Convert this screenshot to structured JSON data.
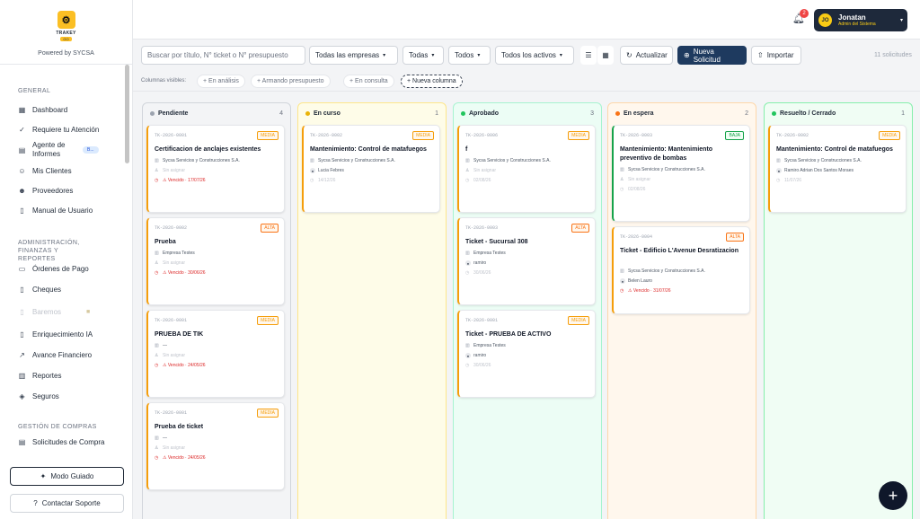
{
  "brand": {
    "name": "TRAKEY",
    "badge": "GO",
    "powered": "Powered by SYCSA"
  },
  "sidebar": {
    "sections": [
      {
        "title": "GENERAL",
        "items": [
          {
            "label": "Dashboard",
            "icon": "grid-icon"
          },
          {
            "label": "Requiere tu Atención",
            "icon": "check-circle-icon"
          },
          {
            "label": "Agente de Informes",
            "icon": "document-icon",
            "badge": "B..."
          },
          {
            "label": "Mis Clientes",
            "icon": "users-icon"
          },
          {
            "label": "Proveedores",
            "icon": "people-icon"
          },
          {
            "label": "Manual de Usuario",
            "icon": "book-icon"
          }
        ]
      },
      {
        "title": "ADMINISTRACIÓN, FINANZAS Y REPORTES",
        "items": [
          {
            "label": "Órdenes de Pago",
            "icon": "card-icon"
          },
          {
            "label": "Cheques",
            "icon": "file-icon"
          },
          {
            "label": "Baremos",
            "icon": "file-icon",
            "disabled": true
          },
          {
            "label": "Enriquecimiento IA",
            "icon": "file-icon"
          },
          {
            "label": "Avance Financiero",
            "icon": "trend-icon"
          },
          {
            "label": "Reportes",
            "icon": "bar-chart-icon"
          },
          {
            "label": "Seguros",
            "icon": "shield-icon"
          }
        ]
      },
      {
        "title": "GESTIÓN DE COMPRAS",
        "items": [
          {
            "label": "Solicitudes de Compra",
            "icon": "clipboard-icon"
          }
        ]
      }
    ],
    "guided_mode": "Modo Guiado",
    "support": "Contactar Soporte"
  },
  "header": {
    "notifications": "2",
    "user": {
      "initials": "JO",
      "name": "Jonatan",
      "role": "Admin del Sistema"
    }
  },
  "toolbar": {
    "search_placeholder": "Buscar por título, N° ticket o N° presupuesto",
    "filters": [
      "Todas las empresas",
      "Todas",
      "Todos",
      "Todos los activos"
    ],
    "refresh": "Actualizar",
    "new_request": "Nueva Solicitud",
    "import": "Importar",
    "count": "11 solicitudes"
  },
  "visible_columns": {
    "label": "Columnas visibles:",
    "options": [
      "+ En análisis",
      "+ Armando presupuesto",
      "+ En consulta",
      "+ Nueva columna"
    ]
  },
  "board": {
    "columns": [
      {
        "title": "Pendiente",
        "count": "4",
        "color": "#9ca3af",
        "bg": "#f3f4f6",
        "border": "#d1d5db",
        "accent": "#f59e0b",
        "cards": [
          {
            "id": "TK-2026-0001",
            "priority": "MEDIA",
            "title": "Certificacion de anclajes existentes",
            "company": "Sycsa Servicios y Construcciones S.A.",
            "assignee": "Sin asignar",
            "due": "⚠ Vencido · 17/07/26"
          },
          {
            "id": "TK-2026-0002",
            "priority": "ALTA",
            "title": "Prueba",
            "company": "Empresa Testes",
            "assignee": "Sin asignar",
            "due": "⚠ Vencido · 30/06/26"
          },
          {
            "id": "TK-2026-0001",
            "priority": "MEDIA",
            "title": "PRUEBA DE TIK",
            "company": "—",
            "assignee": "Sin asignar",
            "due": "⚠ Vencido · 24/05/26"
          },
          {
            "id": "TK-2026-0001",
            "priority": "MEDIA",
            "title": "Prueba de ticket",
            "company": "—",
            "assignee": "Sin asignar",
            "due": "⚠ Vencido · 24/05/26"
          }
        ]
      },
      {
        "title": "En curso",
        "count": "1",
        "color": "#eab308",
        "bg": "#fefce8",
        "border": "#fde68a",
        "accent": "#f59e0b",
        "cards": [
          {
            "id": "TK-2026-0002",
            "priority": "MEDIA",
            "title": "Mantenimiento: Control de matafuegos",
            "company": "Sycsa Servicios y Construcciones S.A.",
            "assignee": "Lucia Febres",
            "due": "14/12/26"
          }
        ]
      },
      {
        "title": "Aprobado",
        "count": "3",
        "color": "#22c55e",
        "bg": "#ecfdf5",
        "border": "#a7f3d0",
        "accent": "#f59e0b",
        "cards": [
          {
            "id": "TK-2026-0006",
            "priority": "MEDIA",
            "title": "f",
            "company": "Sycsa Servicios y Construcciones S.A.",
            "assignee": "Sin asignar",
            "due": "02/08/26"
          },
          {
            "id": "TK-2026-0003",
            "priority": "ALTA",
            "title": "Ticket - Sucursal 308",
            "company": "Empresa Testes",
            "assignee": "ramiro",
            "due": "30/06/26"
          },
          {
            "id": "TK-2026-0001",
            "priority": "MEDIA",
            "title": "Ticket - PRUEBA DE ACTIVO",
            "company": "Empresa Testes",
            "assignee": "ramiro",
            "due": "30/06/26"
          }
        ]
      },
      {
        "title": "En espera",
        "count": "2",
        "color": "#f97316",
        "bg": "#fff7ed",
        "border": "#fed7aa",
        "accent": "#f59e0b",
        "cards": [
          {
            "id": "TK-2026-0003",
            "priority": "BAJA",
            "title": "Mantenimiento: Mantenimiento preventivo de bombas",
            "company": "Sycsa Servicios y Construcciones S.A.",
            "assignee": "Sin asignar",
            "due": "02/08/26"
          },
          {
            "id": "TK-2026-0004",
            "priority": "ALTA",
            "title": "Ticket - Edificio L'Avenue Desratizacion",
            "company": "Sycsa Servicios y Construcciones S.A.",
            "assignee": "Belen Lauro",
            "due": "⚠ Vencido · 31/07/26"
          }
        ]
      },
      {
        "title": "Resuelto / Cerrado",
        "count": "1",
        "color": "#22c55e",
        "bg": "#f0fdf4",
        "border": "#86efac",
        "accent": "#f59e0b",
        "cards": [
          {
            "id": "TK-2026-0002",
            "priority": "MEDIA",
            "title": "Mantenimiento: Control de matafuegos",
            "company": "Sycsa Servicios y Construcciones S.A.",
            "assignee": "Ramiro Adrian Dos Santos Moraes",
            "due": "11/07/26"
          }
        ]
      }
    ]
  },
  "priority_colors": {
    "MEDIA": "#f59e0b",
    "ALTA": "#f97316",
    "BAJA": "#16a34a"
  }
}
